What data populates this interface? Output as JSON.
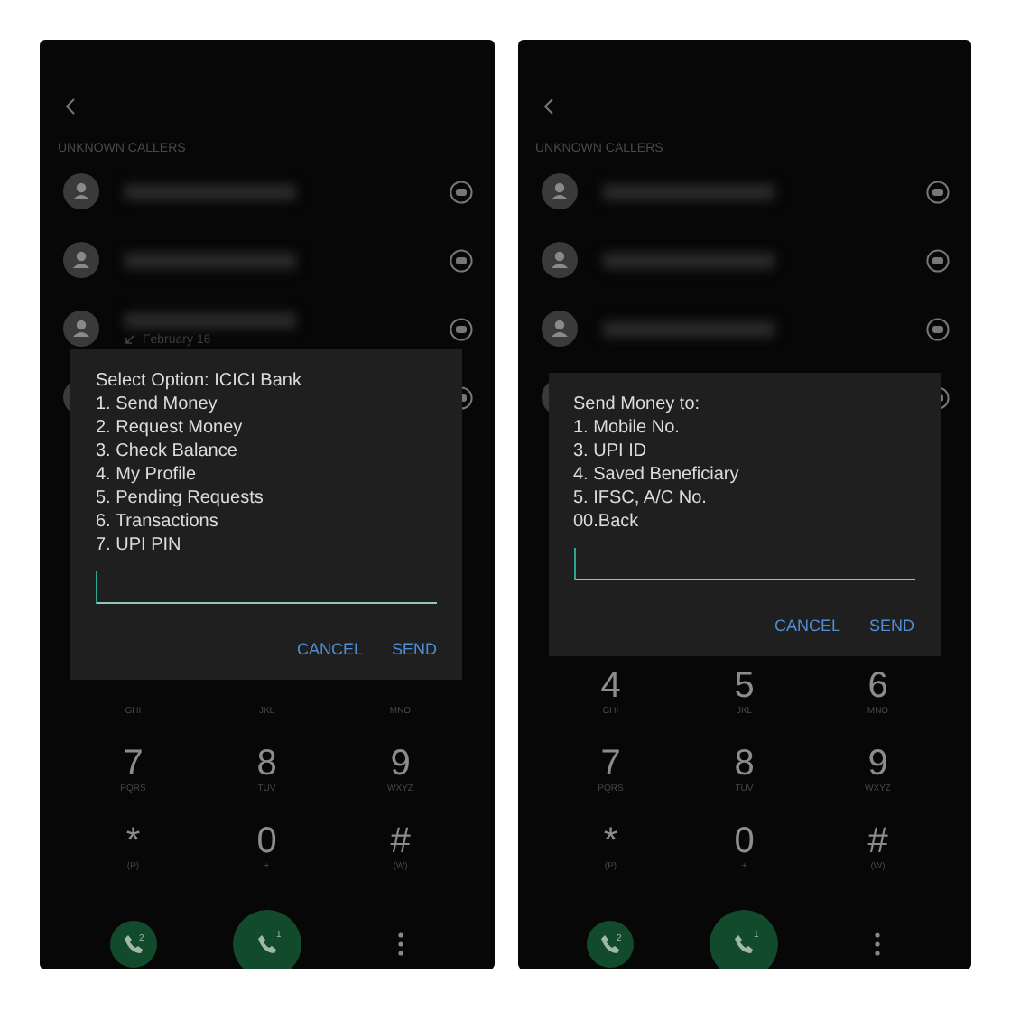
{
  "screens": [
    {
      "section_label": "UNKNOWN CALLERS",
      "callers": [
        {
          "kind": "contact"
        },
        {
          "kind": "contact"
        },
        {
          "kind": "contact",
          "detail": "February 16"
        },
        {
          "kind": "partial"
        }
      ],
      "keys": [
        {
          "letters": "GHI"
        },
        {
          "letters": "JKL"
        },
        {
          "letters": "MNO"
        },
        {
          "digit": "7",
          "letters": "PQRS"
        },
        {
          "digit": "8",
          "letters": "TUV"
        },
        {
          "digit": "9",
          "letters": "WXYZ"
        },
        {
          "digit": "*",
          "letters": "(P)"
        },
        {
          "digit": "0",
          "letters": "+"
        },
        {
          "digit": "#",
          "letters": "(W)"
        }
      ],
      "call_buttons": [
        {
          "kind": "small",
          "badge": "2"
        },
        {
          "kind": "large",
          "badge": "1"
        }
      ],
      "dialog": {
        "title": "Select Option: ICICI Bank",
        "options": [
          "1. Send Money",
          "2. Request Money",
          "3. Check Balance",
          "4. My Profile",
          "5. Pending Requests",
          "6. Transactions",
          "7. UPI PIN"
        ],
        "actions": [
          "CANCEL",
          "SEND"
        ]
      }
    },
    {
      "section_label": "UNKNOWN CALLERS",
      "callers": [
        {
          "kind": "contact"
        },
        {
          "kind": "contact"
        },
        {
          "kind": "contact"
        },
        {
          "kind": "partial"
        }
      ],
      "keys": [
        {
          "digit": "4",
          "letters": "GHI"
        },
        {
          "digit": "5",
          "letters": "JKL"
        },
        {
          "digit": "6",
          "letters": "MNO"
        },
        {
          "digit": "7",
          "letters": "PQRS"
        },
        {
          "digit": "8",
          "letters": "TUV"
        },
        {
          "digit": "9",
          "letters": "WXYZ"
        },
        {
          "digit": "*",
          "letters": "(P)"
        },
        {
          "digit": "0",
          "letters": "+"
        },
        {
          "digit": "#",
          "letters": "(W)"
        }
      ],
      "call_buttons": [
        {
          "kind": "small",
          "badge": "2"
        },
        {
          "kind": "large",
          "badge": "1"
        }
      ],
      "dialog": {
        "title": "Send Money to:",
        "options": [
          "1. Mobile No.",
          "3. UPI ID",
          "4. Saved Beneficiary",
          "5. IFSC, A/C No.",
          "00.Back"
        ],
        "actions": [
          "CANCEL",
          "SEND"
        ]
      }
    }
  ]
}
